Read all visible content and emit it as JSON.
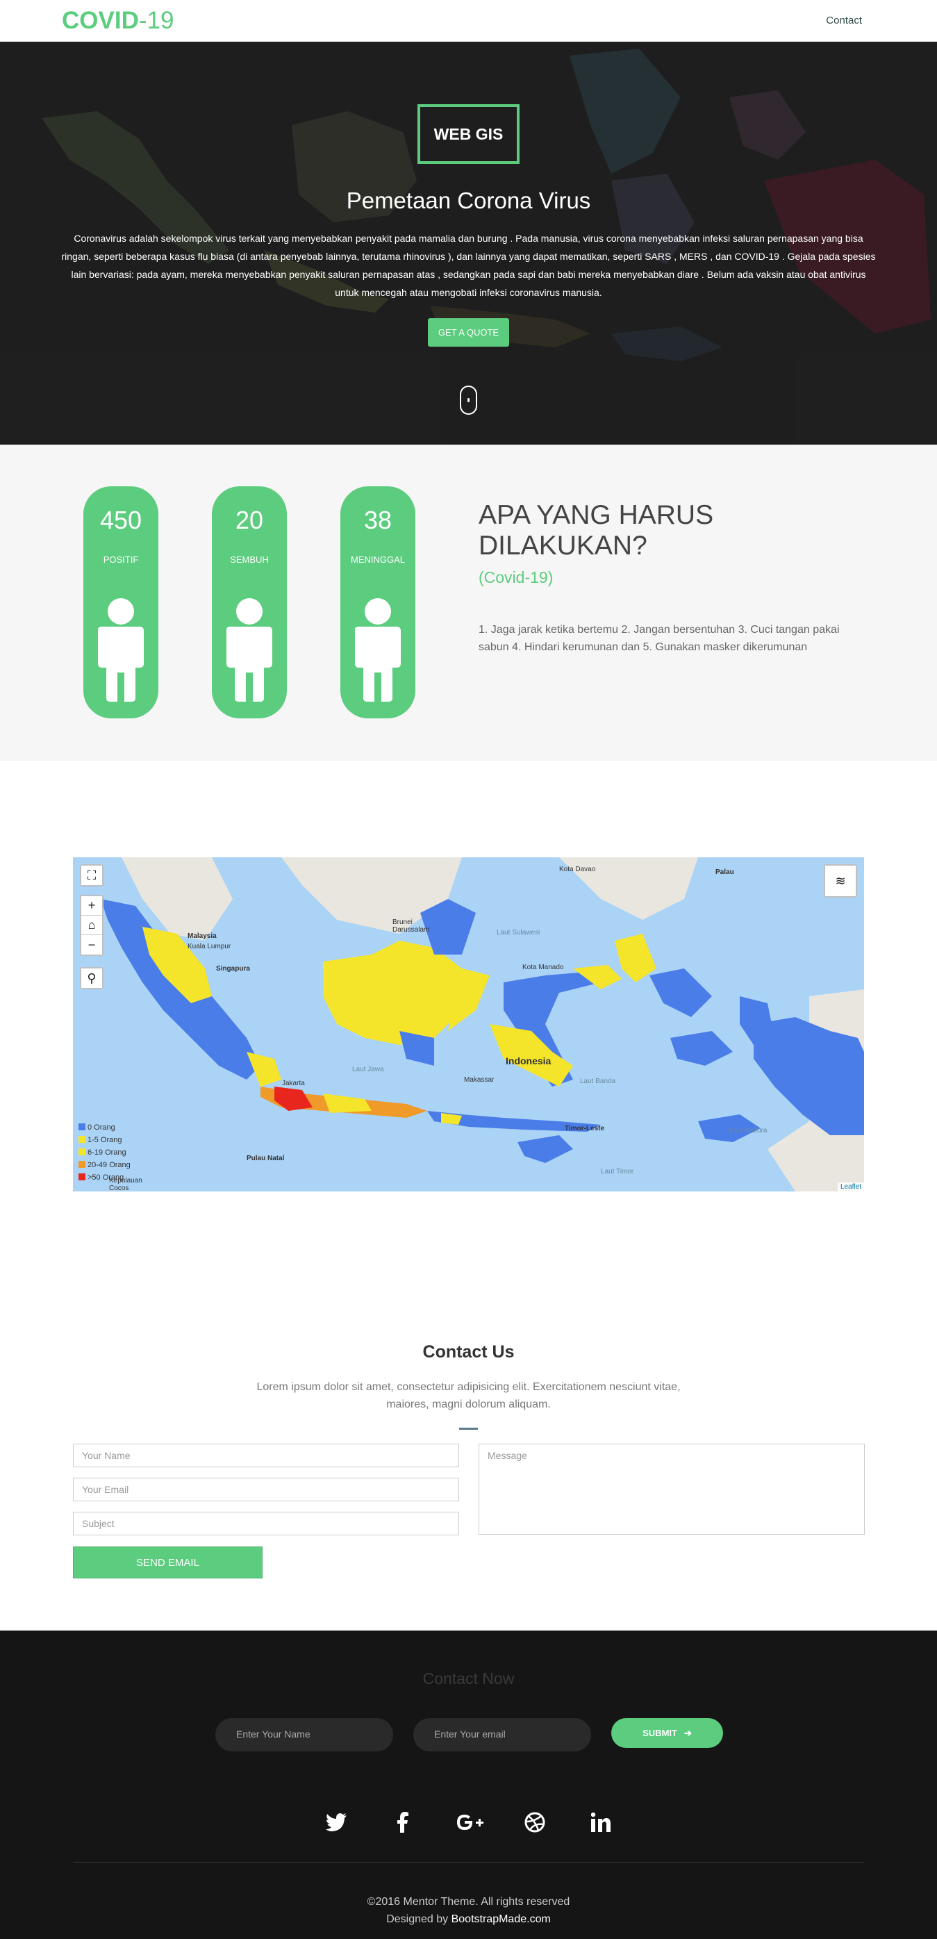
{
  "nav": {
    "logo_bold": "COVID",
    "logo_rest": "-19",
    "contact_link": "Contact"
  },
  "hero": {
    "badge": "WEB GIS",
    "title": "Pemetaan Corona Virus",
    "text": "Coronavirus adalah sekelompok virus terkait yang menyebabkan penyakit pada mamalia dan burung . Pada manusia, virus corona menyebabkan infeksi saluran pernapasan yang bisa ringan, seperti beberapa kasus flu biasa (di antara penyebab lainnya, terutama rhinovirus ), dan lainnya yang dapat mematikan, seperti SARS , MERS , dan COVID-19 . Gejala pada spesies lain bervariasi: pada ayam, mereka menyebabkan penyakit saluran pernapasan atas , sedangkan pada sapi dan babi mereka menyebabkan diare . Belum ada vaksin atau obat antivirus untuk mencegah atau mengobati infeksi coronavirus manusia.",
    "button": "GET A QUOTE"
  },
  "stats": {
    "items": [
      {
        "value": "450",
        "label": "POSITIF"
      },
      {
        "value": "20",
        "label": "SEMBUH"
      },
      {
        "value": "38",
        "label": "MENINGGAL"
      }
    ],
    "heading": "APA YANG HARUS DILAKUKAN?",
    "subheading": "(Covid-19)",
    "text": "1. Jaga jarak ketika bertemu 2. Jangan bersentuhan 3. Cuci tangan pakai sabun 4. Hindari kerumunan dan 5. Gunakan masker dikerumunan"
  },
  "map": {
    "legend": [
      {
        "label": "0 Orang",
        "color": "#4a7de8"
      },
      {
        "label": "1-5 Orang",
        "color": "#f5e52a"
      },
      {
        "label": "6-19 Orang",
        "color": "#f5e52a"
      },
      {
        "label": "20-49 Orang",
        "color": "#f09a2a"
      },
      {
        "label": ">50 Orang",
        "color": "#e8261e"
      }
    ],
    "labels": {
      "malaysia": "Malaysia",
      "singapore": "Singapura",
      "indonesia": "Indonesia",
      "jakarta": "Jakarta",
      "makassar": "Makassar",
      "timor": "Timor-Leste",
      "palau": "Palau",
      "davao": "Kota Davao",
      "brunei": "Brunei Darussalam",
      "manado": "Kota Manado",
      "natal": "Pulau Natal",
      "cocos": "Kepulauan Cocos",
      "laut_jawa": "Laut Jawa",
      "laut_banda": "Laut Banda",
      "laut_timor": "Laut Timor",
      "laut_arafura": "Laut Arafura",
      "laut_sulawesi": "Laut Sulawesi",
      "kuala": "Kuala Lumpur"
    },
    "attribution": "Leaflet"
  },
  "contact": {
    "title": "Contact Us",
    "text": "Lorem ipsum dolor sit amet, consectetur adipisicing elit. Exercitationem nesciunt vitae, maiores, magni dolorum aliquam.",
    "name_placeholder": "Your Name",
    "email_placeholder": "Your Email",
    "subject_placeholder": "Subject",
    "message_placeholder": "Message",
    "send": "SEND EMAIL"
  },
  "footer": {
    "title": "Contact Now",
    "name_placeholder": "Enter Your Name",
    "email_placeholder": "Enter Your email",
    "submit": "SUBMIT",
    "copyright": "©2016 Mentor Theme. All rights reserved",
    "designed_prefix": "Designed by",
    "designed_brand": "BootstrapMade.com"
  }
}
